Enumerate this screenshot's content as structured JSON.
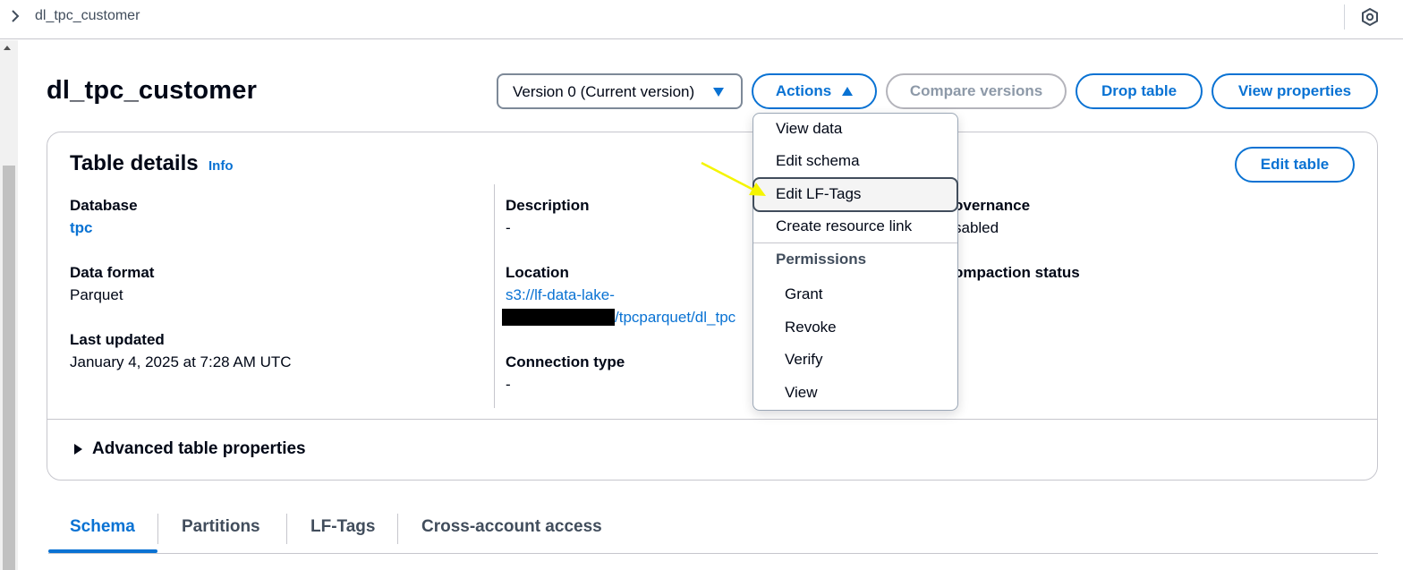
{
  "breadcrumb": {
    "current": "dl_tpc_customer"
  },
  "page": {
    "title": "dl_tpc_customer"
  },
  "header": {
    "version_select": "Version 0 (Current version)",
    "actions_label": "Actions",
    "compare_label": "Compare versions",
    "drop_label": "Drop table",
    "view_props_label": "View properties"
  },
  "details": {
    "title": "Table details",
    "info": "Info",
    "edit_label": "Edit table",
    "database_label": "Database",
    "database_value": "tpc",
    "format_label": "Data format",
    "format_value": "Parquet",
    "updated_label": "Last updated",
    "updated_value": "January 4, 2025 at 7:28 AM UTC",
    "description_label": "Description",
    "description_value": "-",
    "location_label": "Location",
    "location_line1": "s3://lf-data-lake-",
    "location_line2": "/tpcparquet/dl_tpc",
    "connection_label": "Connection type",
    "connection_value": "-",
    "governance_label": "overnance",
    "governance_value": "sabled",
    "compaction_label": "ompaction status",
    "advanced_label": "Advanced table properties"
  },
  "tabs": [
    "Schema",
    "Partitions",
    "LF-Tags",
    "Cross-account access"
  ],
  "menu": {
    "items": [
      "View data",
      "Edit schema",
      "Edit LF-Tags",
      "Create resource link"
    ],
    "group_label": "Permissions",
    "group_items": [
      "Grant",
      "Revoke",
      "Verify",
      "View"
    ]
  },
  "colors": {
    "accent": "#0972d3",
    "annotation_arrow": "#f5f500"
  }
}
